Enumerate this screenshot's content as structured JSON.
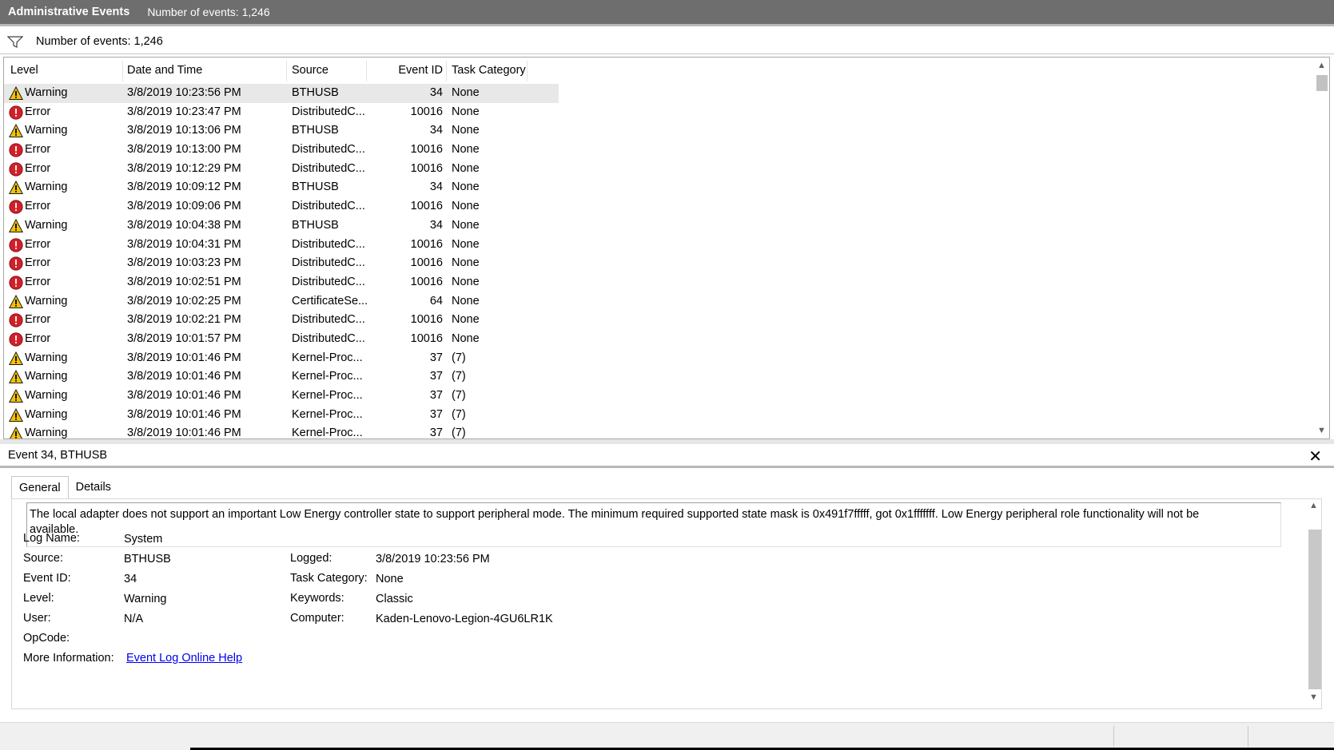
{
  "window": {
    "title": "Administrative Events",
    "event_count": "Number of events: 1,246"
  },
  "filter_bar": {
    "icon": "filter-icon",
    "text": "Number of events: 1,246"
  },
  "table": {
    "columns": [
      "Level",
      "Date and Time",
      "Source",
      "Event ID",
      "Task Category"
    ],
    "rows": [
      {
        "level": "Warning",
        "date": "3/8/2019 10:23:56 PM",
        "source": "BTHUSB",
        "id": "34",
        "cat": "None"
      },
      {
        "level": "Error",
        "date": "3/8/2019 10:23:47 PM",
        "source": "DistributedC...",
        "id": "10016",
        "cat": "None"
      },
      {
        "level": "Warning",
        "date": "3/8/2019 10:13:06 PM",
        "source": "BTHUSB",
        "id": "34",
        "cat": "None"
      },
      {
        "level": "Error",
        "date": "3/8/2019 10:13:00 PM",
        "source": "DistributedC...",
        "id": "10016",
        "cat": "None"
      },
      {
        "level": "Error",
        "date": "3/8/2019 10:12:29 PM",
        "source": "DistributedC...",
        "id": "10016",
        "cat": "None"
      },
      {
        "level": "Warning",
        "date": "3/8/2019 10:09:12 PM",
        "source": "BTHUSB",
        "id": "34",
        "cat": "None"
      },
      {
        "level": "Error",
        "date": "3/8/2019 10:09:06 PM",
        "source": "DistributedC...",
        "id": "10016",
        "cat": "None"
      },
      {
        "level": "Warning",
        "date": "3/8/2019 10:04:38 PM",
        "source": "BTHUSB",
        "id": "34",
        "cat": "None"
      },
      {
        "level": "Error",
        "date": "3/8/2019 10:04:31 PM",
        "source": "DistributedC...",
        "id": "10016",
        "cat": "None"
      },
      {
        "level": "Error",
        "date": "3/8/2019 10:03:23 PM",
        "source": "DistributedC...",
        "id": "10016",
        "cat": "None"
      },
      {
        "level": "Error",
        "date": "3/8/2019 10:02:51 PM",
        "source": "DistributedC...",
        "id": "10016",
        "cat": "None"
      },
      {
        "level": "Warning",
        "date": "3/8/2019 10:02:25 PM",
        "source": "CertificateSe...",
        "id": "64",
        "cat": "None"
      },
      {
        "level": "Error",
        "date": "3/8/2019 10:02:21 PM",
        "source": "DistributedC...",
        "id": "10016",
        "cat": "None"
      },
      {
        "level": "Error",
        "date": "3/8/2019 10:01:57 PM",
        "source": "DistributedC...",
        "id": "10016",
        "cat": "None"
      },
      {
        "level": "Warning",
        "date": "3/8/2019 10:01:46 PM",
        "source": "Kernel-Proc...",
        "id": "37",
        "cat": "(7)"
      },
      {
        "level": "Warning",
        "date": "3/8/2019 10:01:46 PM",
        "source": "Kernel-Proc...",
        "id": "37",
        "cat": "(7)"
      },
      {
        "level": "Warning",
        "date": "3/8/2019 10:01:46 PM",
        "source": "Kernel-Proc...",
        "id": "37",
        "cat": "(7)"
      },
      {
        "level": "Warning",
        "date": "3/8/2019 10:01:46 PM",
        "source": "Kernel-Proc...",
        "id": "37",
        "cat": "(7)"
      },
      {
        "level": "Warning",
        "date": "3/8/2019 10:01:46 PM",
        "source": "Kernel-Proc...",
        "id": "37",
        "cat": "(7)"
      }
    ]
  },
  "detail": {
    "title": "Event 34, BTHUSB",
    "close_glyph": "✕",
    "tabs": [
      "General",
      "Details"
    ],
    "description_line1": "The local adapter does not support an important Low Energy controller state to support peripheral mode.  The minimum required supported state mask is 0x491f7fffff, got 0x1fffffff.  Low Energy peripheral role functionality will not be",
    "description_line2": "available.",
    "fields": {
      "log_name_label": "Log Name:",
      "log_name": "System",
      "source_label": "Source:",
      "source": "BTHUSB",
      "logged_label": "Logged:",
      "logged": "3/8/2019 10:23:56 PM",
      "event_id_label": "Event ID:",
      "event_id": "34",
      "task_category_label": "Task Category:",
      "task_category": "None",
      "level_label": "Level:",
      "level": "Warning",
      "keywords_label": "Keywords:",
      "keywords": "Classic",
      "user_label": "User:",
      "user": "N/A",
      "computer_label": "Computer:",
      "computer": "Kaden-Lenovo-Legion-4GU6LR1K",
      "opcode_label": "OpCode:",
      "more_info_label": "More Information:",
      "more_info_link": "Event Log Online Help"
    }
  },
  "colors": {
    "titlebar": "#6e6e6e",
    "warning": "#f2c200",
    "error": "#d0202a",
    "link": "#0000ee",
    "selected_row": "#e8e8e8"
  }
}
